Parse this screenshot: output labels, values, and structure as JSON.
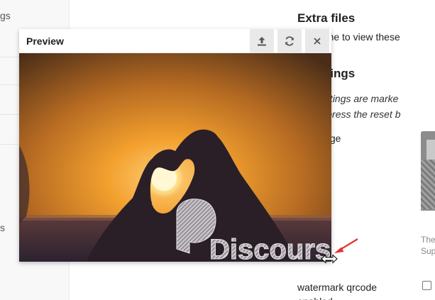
{
  "left_nav": {
    "items": [
      {
        "label": "gs"
      },
      {
        "label": "s"
      }
    ]
  },
  "main": {
    "extra_files_heading": "Extra files",
    "extra_files_text": "ort theme to view these",
    "settings_heading": "e Settings",
    "help_line1": "den settings are marke",
    "help_line2": "value, press the reset b",
    "watermark_image_label": "ark image",
    "watermark_image_desc_line1": "The",
    "watermark_image_desc_line2": "Sup",
    "qrcode_label": "watermark qrcode enabled",
    "qrcode_checked": false
  },
  "preview": {
    "title": "Preview",
    "upload_icon": "upload-icon",
    "refresh_icon": "refresh-icon",
    "close_icon": "close-icon",
    "watermark_text": "Discourse",
    "colors": {
      "sky_top": "#7a4a1c",
      "sky_glow": "#f3a02e",
      "sun": "#fff6c2",
      "silhouette": "#2a1f26"
    }
  },
  "annotation": {
    "arrow_color": "#e0342f",
    "cursor_icon": "resize-horizontal-icon"
  }
}
